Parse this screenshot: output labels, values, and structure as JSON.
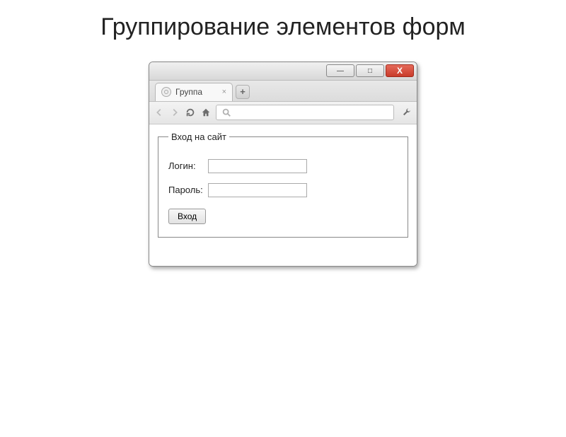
{
  "slide": {
    "title": "Группирование элементов форм"
  },
  "window": {
    "minimize": "—",
    "maximize": "□",
    "close": "X"
  },
  "tab": {
    "title": "Группа",
    "close": "×",
    "newtab": "+"
  },
  "toolbar": {
    "search_value": ""
  },
  "form": {
    "legend": "Вход на сайт",
    "login_label": "Логин:",
    "login_value": "",
    "password_label": "Пароль:",
    "password_value": "",
    "submit_label": "Вход"
  }
}
